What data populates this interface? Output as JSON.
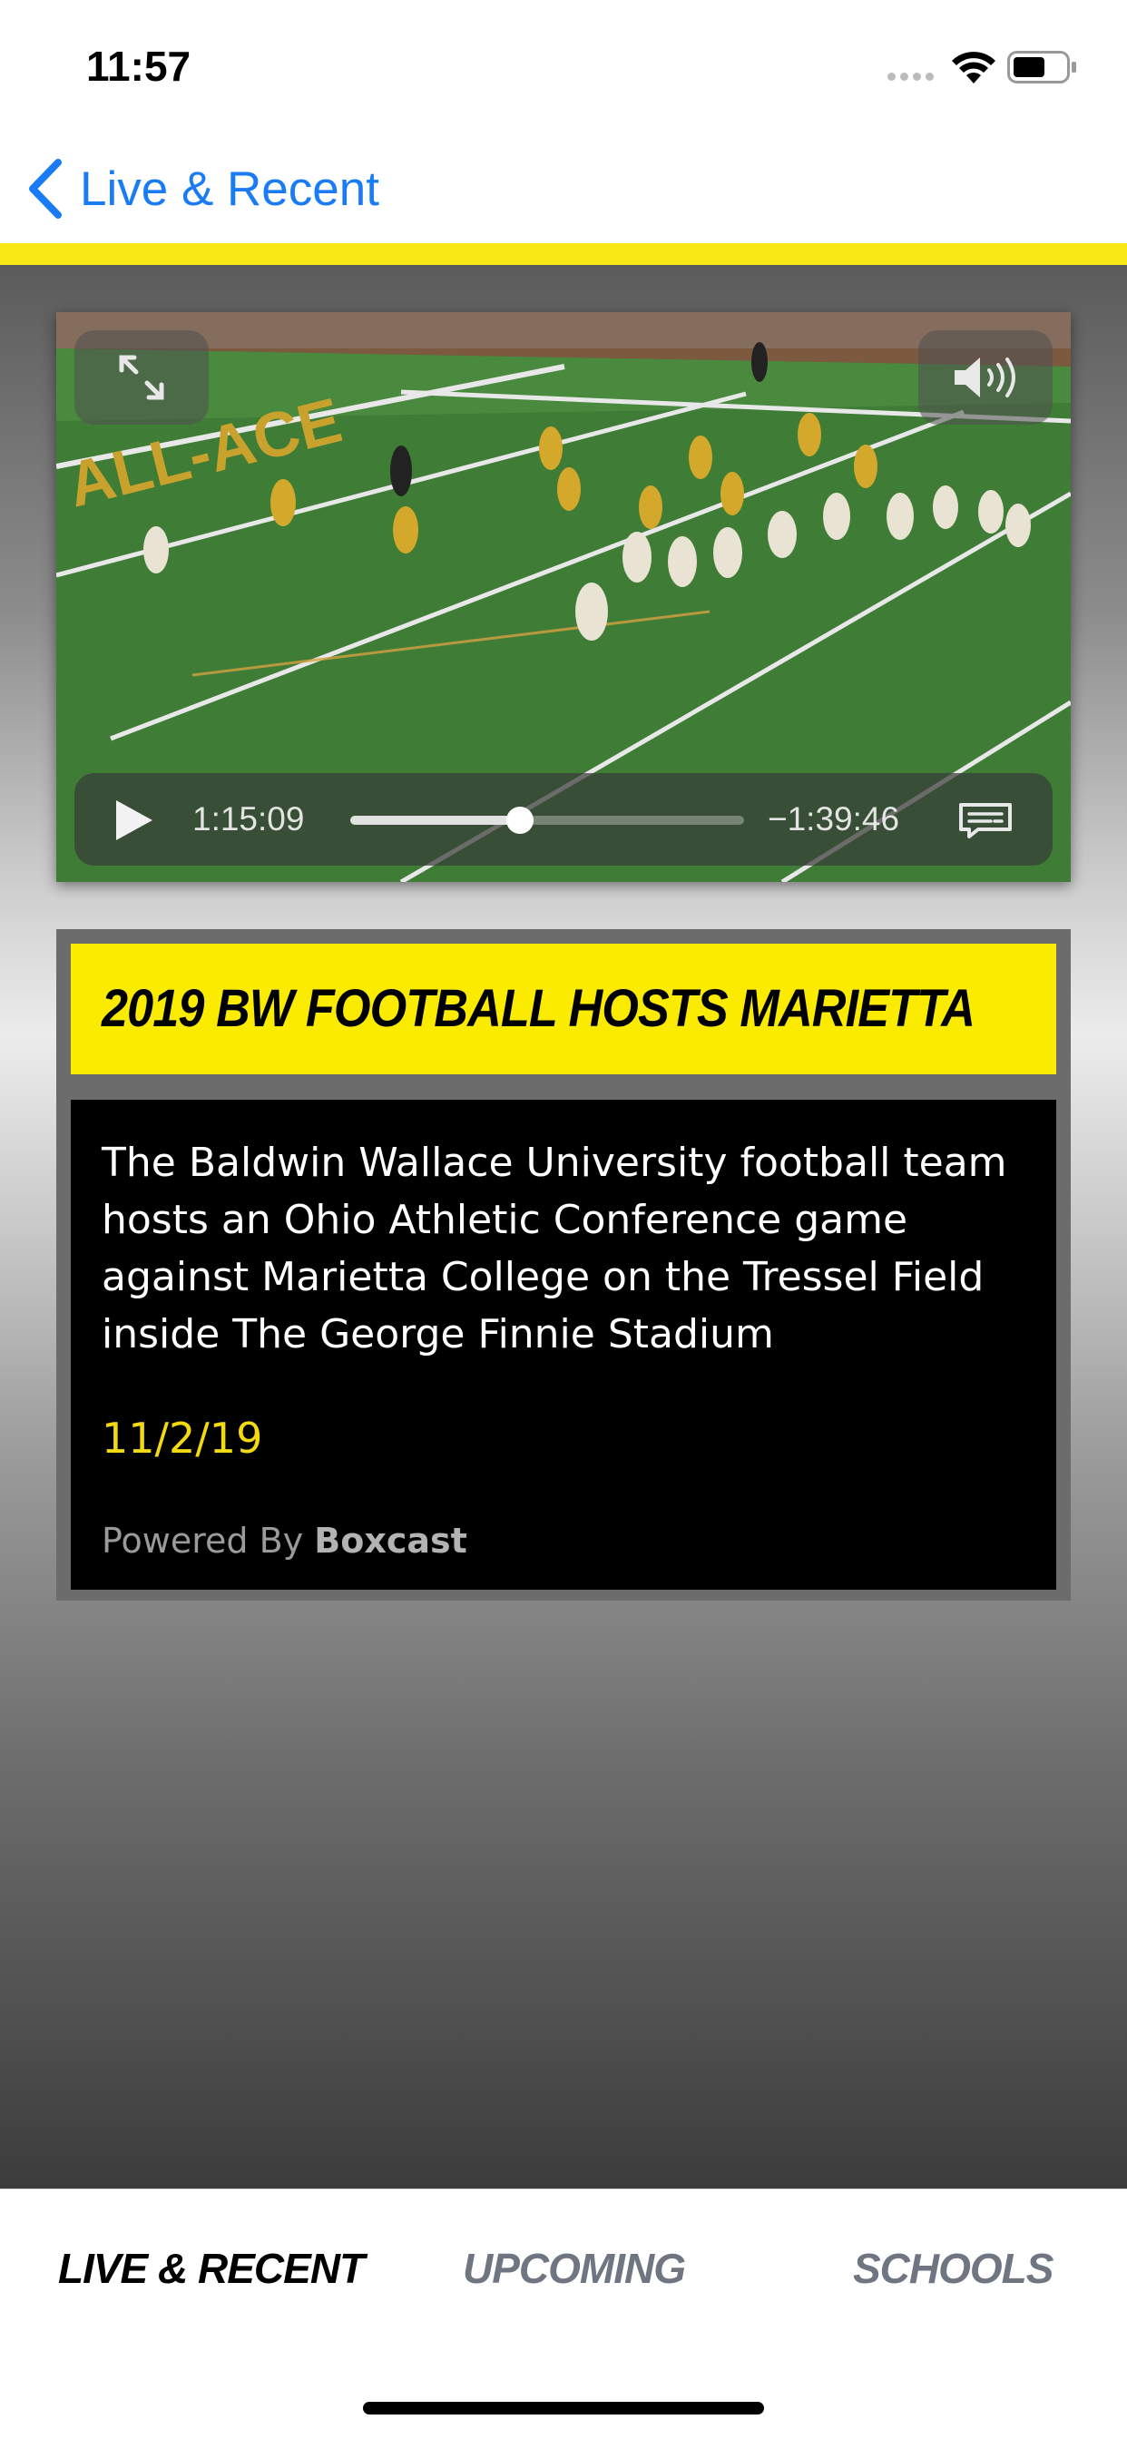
{
  "status_bar": {
    "time": "11:57",
    "icons": [
      "signal-dots-icon",
      "wifi-icon",
      "battery-icon"
    ]
  },
  "nav": {
    "back_label": "Live & Recent",
    "back_icon": "chevron-left-icon",
    "accent_color": "#f8e816",
    "link_color": "#1a7cf5"
  },
  "video": {
    "elapsed": "1:15:09",
    "remaining": "−1:39:46",
    "progress": 0.43,
    "icons": [
      "fullscreen-icon",
      "volume-icon",
      "play-icon",
      "captions-icon"
    ]
  },
  "event": {
    "title": "2019 BW FOOTBALL HOSTS MARIETTA",
    "description": "The Baldwin Wallace University football team hosts an Ohio Athletic Conference game against Marietta College on the Tressel Field inside The George Finnie Stadium",
    "date": "11/2/19",
    "powered_prefix": "Powered By",
    "powered_brand": "Boxcast",
    "title_bg_color": "#fbeb00",
    "date_color": "#f3da10"
  },
  "tabs": [
    {
      "label": "LIVE & RECENT",
      "active": true
    },
    {
      "label": "UPCOMING",
      "active": false
    },
    {
      "label": "SCHOOLS",
      "active": false
    }
  ]
}
